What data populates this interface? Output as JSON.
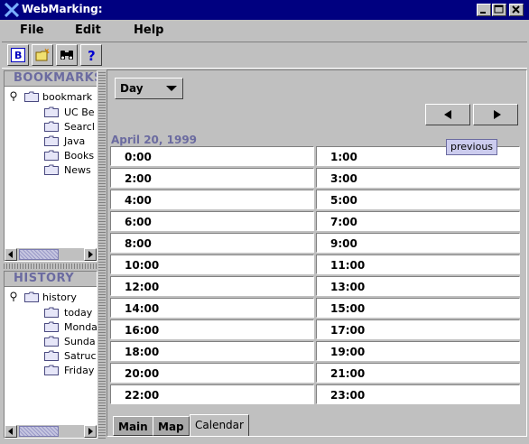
{
  "window": {
    "title": "WebMarking:"
  },
  "menu": [
    "File",
    "Edit",
    "Help"
  ],
  "toolbar_icons": [
    "bookmark-b-icon",
    "new-folder-icon",
    "binoculars-icon",
    "help-icon"
  ],
  "toolbar_labels": {
    "b": "B",
    "help": "?"
  },
  "bookmarks": {
    "header": "BOOKMARKS",
    "root": "bookmark",
    "items": [
      "UC Be",
      "Searcl",
      "Java",
      "Books",
      "News"
    ]
  },
  "history": {
    "header": "HISTORY",
    "root": "history",
    "items": [
      "today",
      "Monda",
      "Sunda",
      "Satruc",
      "Friday"
    ]
  },
  "calendar": {
    "view": "Day",
    "date": "April 20, 1999",
    "tooltip": "previous",
    "hours": [
      "0:00",
      "1:00",
      "2:00",
      "3:00",
      "4:00",
      "5:00",
      "6:00",
      "7:00",
      "8:00",
      "9:00",
      "10:00",
      "11:00",
      "12:00",
      "13:00",
      "14:00",
      "15:00",
      "16:00",
      "17:00",
      "18:00",
      "19:00",
      "20:00",
      "21:00",
      "22:00",
      "23:00"
    ]
  },
  "tabs": [
    "Main",
    "Map",
    "Calendar"
  ],
  "active_tab": "Calendar",
  "colors": {
    "titlebar": "#000080",
    "face": "#c0c0c0",
    "header_text": "#6b6ba0"
  }
}
